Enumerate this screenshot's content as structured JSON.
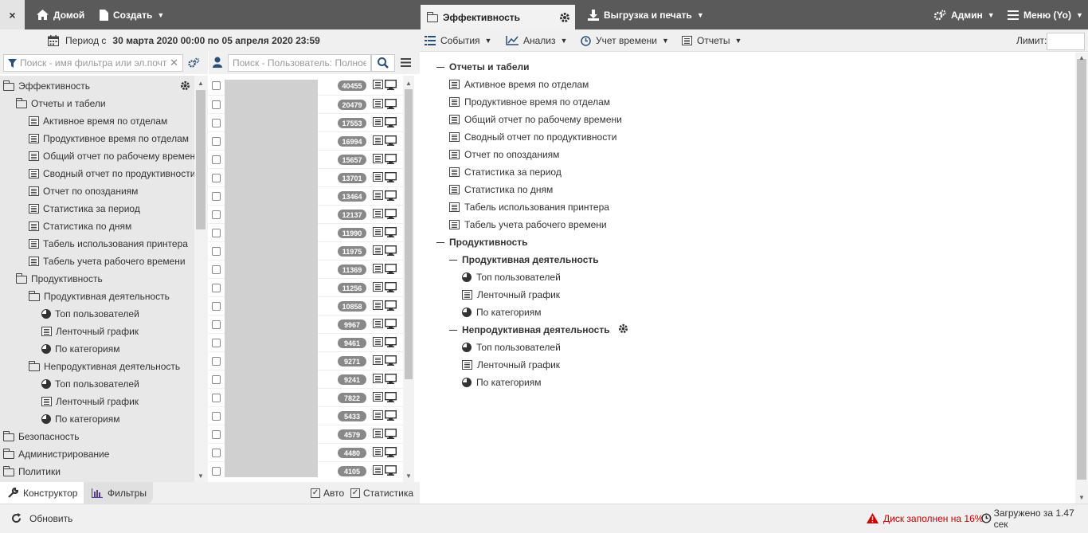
{
  "topbar": {
    "close_label": "×",
    "home_label": "Домой",
    "create_label": "Создать",
    "active_tab_label": "Эффективность",
    "export_label": "Выгрузка и печать",
    "admin_label": "Админ",
    "menu_label": "Меню (Yo)"
  },
  "period": {
    "prefix": "Период с",
    "range": "30 марта 2020 00:00 по 05 апреля 2020 23:59"
  },
  "toolbar": {
    "events_label": "События",
    "analysis_label": "Анализ",
    "time_label": "Учет времени",
    "reports_label": "Отчеты",
    "limit_label": "Лимит:",
    "limit_value": ""
  },
  "filter": {
    "placeholder": "Поиск - имя фильтра или эл.почта"
  },
  "user_search": {
    "placeholder": "Поиск - Пользователь: Полное им"
  },
  "left_tree": [
    {
      "label": "Эффективность",
      "icon": "folder-open-icon",
      "gear": true
    },
    {
      "label": "Отчеты и табели",
      "icon": "folder-open-icon"
    },
    {
      "label": "Активное время по отделам",
      "icon": "report-icon"
    },
    {
      "label": "Продуктивное время по отделам",
      "icon": "report-icon"
    },
    {
      "label": "Общий отчет по рабочему времени",
      "icon": "report-icon"
    },
    {
      "label": "Сводный отчет по продуктивности",
      "icon": "report-icon"
    },
    {
      "label": "Отчет по опозданиям",
      "icon": "report-icon"
    },
    {
      "label": "Статистика за период",
      "icon": "report-icon"
    },
    {
      "label": "Статистика по дням",
      "icon": "report-icon"
    },
    {
      "label": "Табель использования принтера",
      "icon": "report-icon"
    },
    {
      "label": "Табель учета рабочего времени",
      "icon": "report-icon"
    },
    {
      "label": "Продуктивность",
      "icon": "folder-open-icon"
    },
    {
      "label": "Продуктивная деятельность",
      "icon": "folder-open-icon"
    },
    {
      "label": "Топ пользователей",
      "icon": "pie-icon"
    },
    {
      "label": "Ленточный график",
      "icon": "report-icon"
    },
    {
      "label": "По категориям",
      "icon": "pie-icon"
    },
    {
      "label": "Непродуктивная деятельность",
      "icon": "folder-open-icon"
    },
    {
      "label": "Топ пользователей",
      "icon": "pie-icon"
    },
    {
      "label": "Ленточный график",
      "icon": "report-icon"
    },
    {
      "label": "По категориям",
      "icon": "pie-icon"
    },
    {
      "label": "Безопасность",
      "icon": "folder-icon"
    },
    {
      "label": "Администрирование",
      "icon": "folder-icon"
    },
    {
      "label": "Политики",
      "icon": "folder-icon"
    }
  ],
  "users": [
    {
      "count": "40455"
    },
    {
      "count": "20479"
    },
    {
      "count": "17553"
    },
    {
      "count": "16994"
    },
    {
      "count": "15657"
    },
    {
      "count": "13701"
    },
    {
      "count": "13464"
    },
    {
      "count": "12137"
    },
    {
      "count": "11990"
    },
    {
      "count": "11975"
    },
    {
      "count": "11369"
    },
    {
      "count": "11256"
    },
    {
      "count": "10858"
    },
    {
      "count": "9967"
    },
    {
      "count": "9461"
    },
    {
      "count": "9271"
    },
    {
      "count": "9241"
    },
    {
      "count": "7822"
    },
    {
      "count": "5433"
    },
    {
      "count": "4579"
    },
    {
      "count": "4480"
    },
    {
      "count": "4105"
    }
  ],
  "content_tree": [
    {
      "label": "Отчеты и табели",
      "type": "head"
    },
    {
      "label": "Активное время по отделам",
      "icon": "report-icon"
    },
    {
      "label": "Продуктивное время по отделам",
      "icon": "report-icon"
    },
    {
      "label": "Общий отчет по рабочему времени",
      "icon": "report-icon"
    },
    {
      "label": "Сводный отчет по продуктивности",
      "icon": "report-icon"
    },
    {
      "label": "Отчет по опозданиям",
      "icon": "report-icon"
    },
    {
      "label": "Статистика за период",
      "icon": "report-icon"
    },
    {
      "label": "Статистика по дням",
      "icon": "report-icon"
    },
    {
      "label": "Табель использования принтера",
      "icon": "report-icon"
    },
    {
      "label": "Табель учета рабочего времени",
      "icon": "report-icon"
    },
    {
      "label": "Продуктивность",
      "type": "head"
    },
    {
      "label": "Продуктивная деятельность",
      "type": "subhead"
    },
    {
      "label": "Топ пользователей",
      "icon": "pie-icon"
    },
    {
      "label": "Ленточный график",
      "icon": "report-icon"
    },
    {
      "label": "По категориям",
      "icon": "pie-icon"
    },
    {
      "label": "Непродуктивная деятельность",
      "type": "subhead",
      "gear": true
    },
    {
      "label": "Топ пользователей",
      "icon": "pie-icon"
    },
    {
      "label": "Ленточный график",
      "icon": "report-icon"
    },
    {
      "label": "По категориям",
      "icon": "pie-icon"
    }
  ],
  "bottom_tabs": {
    "constructor_label": "Конструктор",
    "filters_label": "Фильтры",
    "auto_label": "Авто",
    "stats_label": "Статистика"
  },
  "footer": {
    "refresh_label": "Обновить",
    "disk_warning": "Диск заполнен на 16%",
    "load_time": "Загружено за 1.47 сек"
  },
  "colors": {
    "topbar": "#5a5a5a",
    "warning": "#cc0000"
  }
}
